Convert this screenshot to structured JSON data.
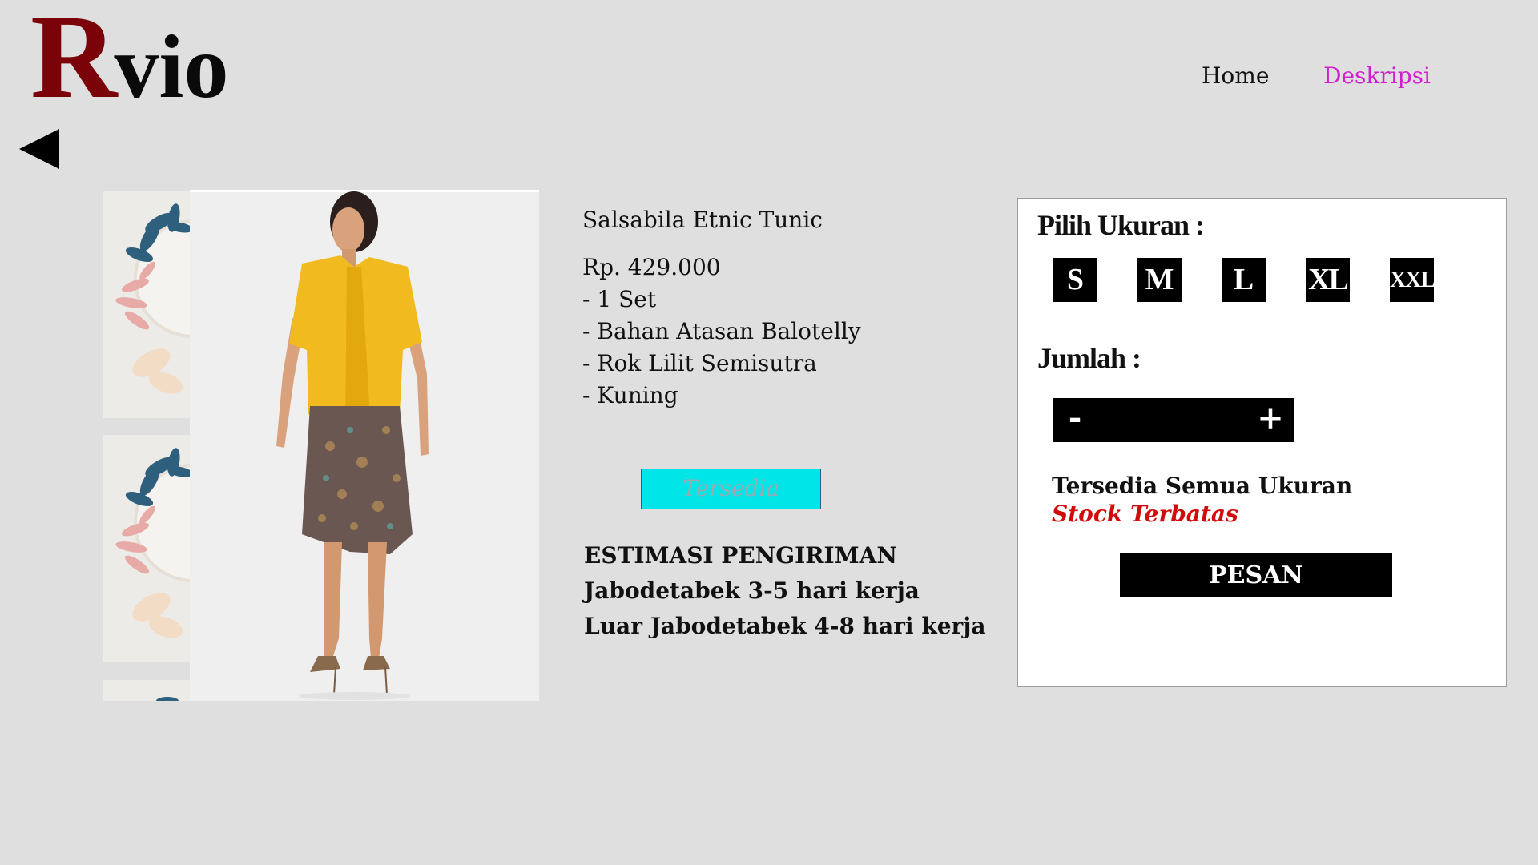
{
  "brand": {
    "logo_letter": "R",
    "logo_rest": "vio",
    "logo_letter_color": "#7a0208"
  },
  "nav": {
    "items": [
      {
        "label": "Home",
        "active": false
      },
      {
        "label": "Deskripsi",
        "active": true,
        "color": "#d21fcd"
      }
    ]
  },
  "back_icon": "left-triangle-icon",
  "product": {
    "name": "Salsabila Etnic Tunic",
    "price": "Rp. 429.000",
    "details": [
      "- 1 Set",
      "- Bahan Atasan Balotelly",
      "- Rok Lilit Semisutra",
      "- Kuning"
    ],
    "status": "Tersedia",
    "shipping": {
      "title": "ESTIMASI PENGIRIMAN",
      "lines": [
        "Jabodetabek 3-5 hari kerja",
        "Luar Jabodetabek 4-8 hari kerja"
      ]
    }
  },
  "order": {
    "size_label": "Pilih Ukuran :",
    "sizes": [
      "S",
      "M",
      "L",
      "XL",
      "XXL"
    ],
    "qty_label": "Jumlah :",
    "qty_minus": "-",
    "qty_plus": "+",
    "qty_value": "",
    "availability": "Tersedia Semua Ukuran",
    "stock_note": "Stock Terbatas",
    "order_button": "PESAN"
  },
  "colors": {
    "status_bg": "#00e6e8",
    "stock_red": "#d10b0b",
    "nav_active": "#d21fcd"
  }
}
